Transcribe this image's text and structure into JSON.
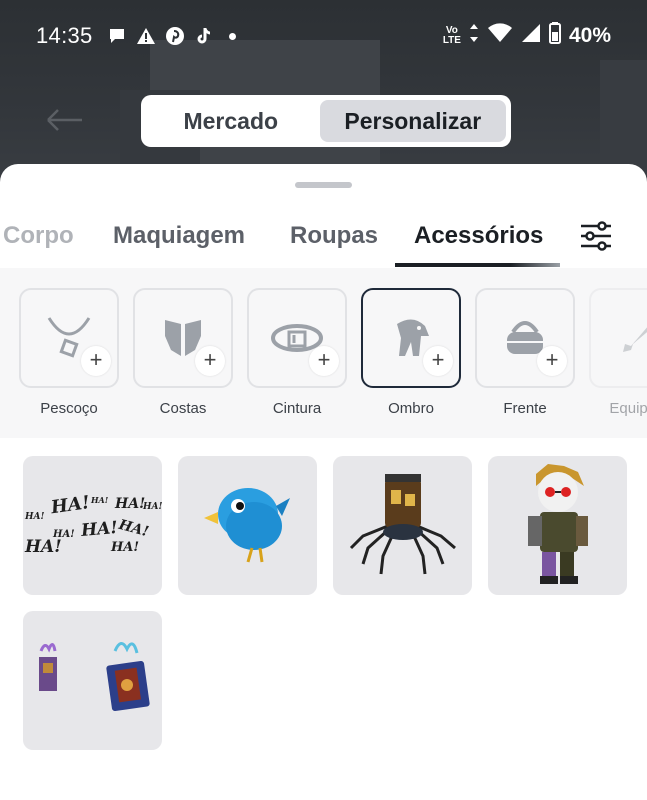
{
  "status_bar": {
    "time": "14:35",
    "volte": [
      "Vo",
      "LTE"
    ],
    "battery": "40%"
  },
  "toggle": {
    "options": [
      "Mercado",
      "Personalizar"
    ],
    "selected": "Personalizar"
  },
  "tabs": [
    "Corpo",
    "Maquiagem",
    "Roupas",
    "Acessórios"
  ],
  "active_tab": "Acessórios",
  "categories": [
    "Pescoço",
    "Costas",
    "Cintura",
    "Ombro",
    "Frente",
    "Equipam"
  ],
  "selected_category": "Ombro",
  "items": {
    "ha_text": [
      "HA!",
      "HA!",
      "HA!",
      "HA!",
      "HA!",
      "HA!",
      "HA!",
      "HA!",
      "HA!",
      "HA!"
    ]
  },
  "colors": {
    "accent_dark": "#1b1f24",
    "sheet_bg": "#ffffff",
    "tile_bg": "#e7e7ea"
  }
}
